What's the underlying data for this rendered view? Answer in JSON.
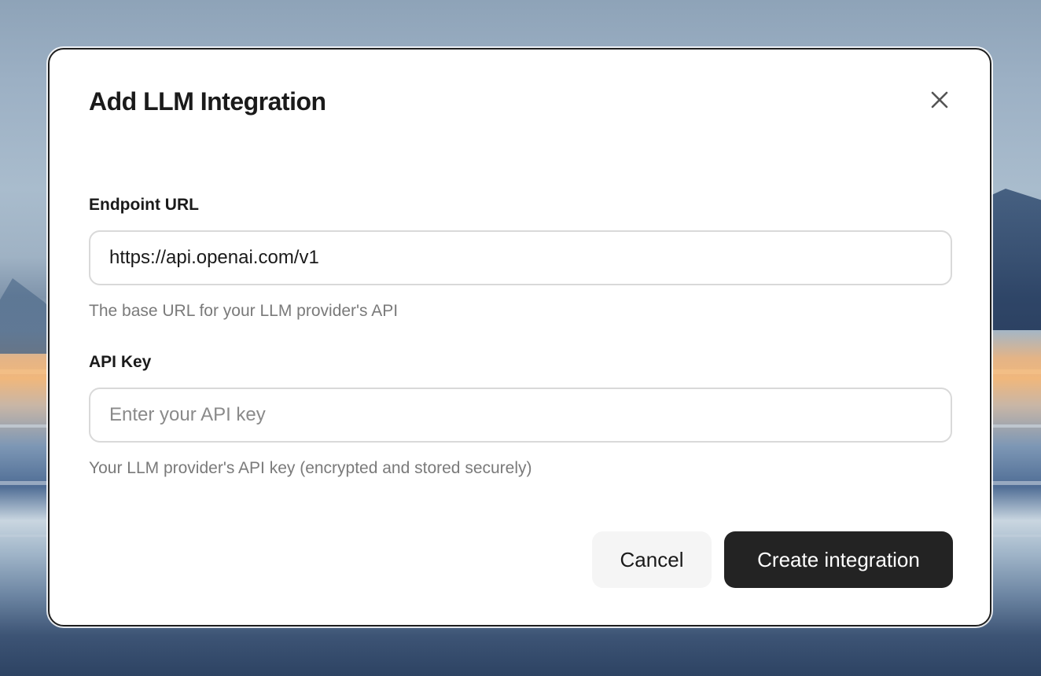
{
  "dialog": {
    "title": "Add LLM Integration",
    "close_icon": "close-icon"
  },
  "fields": {
    "endpoint": {
      "label": "Endpoint URL",
      "value": "https://api.openai.com/v1",
      "helper": "The base URL for your LLM provider's API"
    },
    "api_key": {
      "label": "API Key",
      "value": "",
      "placeholder": "Enter your API key",
      "helper": "Your LLM provider's API key (encrypted and stored securely)"
    }
  },
  "actions": {
    "cancel_label": "Cancel",
    "create_label": "Create integration"
  },
  "colors": {
    "primary_button": "#232323",
    "secondary_button": "#f5f5f5",
    "input_border": "#d9d9d9",
    "helper_text": "#7a7a7a"
  }
}
